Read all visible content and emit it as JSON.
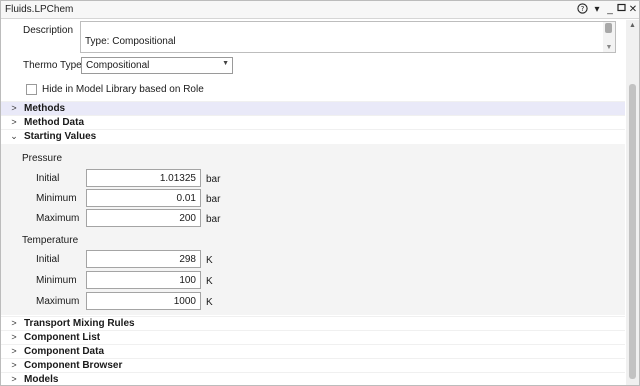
{
  "window": {
    "title": "Fluids.LPChem"
  },
  "description": {
    "label": "Description",
    "text": "Type: Compositional"
  },
  "thermo_type": {
    "label": "Thermo Type",
    "value": "Compositional"
  },
  "hide_checkbox": {
    "label": "Hide in Model Library based on Role",
    "checked": false
  },
  "sections_top": [
    {
      "label": "Methods",
      "expanded": false
    },
    {
      "label": "Method Data",
      "expanded": false
    },
    {
      "label": "Starting Values",
      "expanded": true
    }
  ],
  "starting_values": {
    "pressure": {
      "label": "Pressure",
      "rows": [
        {
          "label": "Initial",
          "value": "1.01325",
          "unit": "bar"
        },
        {
          "label": "Minimum",
          "value": "0.01",
          "unit": "bar"
        },
        {
          "label": "Maximum",
          "value": "200",
          "unit": "bar"
        }
      ]
    },
    "temperature": {
      "label": "Temperature",
      "rows": [
        {
          "label": "Initial",
          "value": "298",
          "unit": "K"
        },
        {
          "label": "Minimum",
          "value": "100",
          "unit": "K"
        },
        {
          "label": "Maximum",
          "value": "1000",
          "unit": "K"
        }
      ]
    }
  },
  "sections_bottom": [
    {
      "label": "Transport Mixing Rules"
    },
    {
      "label": "Component List"
    },
    {
      "label": "Component Data"
    },
    {
      "label": "Component Browser"
    },
    {
      "label": "Models"
    }
  ],
  "icons": {
    "help": "help-icon",
    "dropdown": "dropdown-icon",
    "minimize": "minimize-icon",
    "maximize": "maximize-icon",
    "close": "close-icon",
    "chevron_right": "chevron-right-icon",
    "chevron_down": "chevron-down-icon"
  },
  "colors": {
    "section_highlight": "#e9e9f8",
    "panel_bg": "#f4f4f4"
  }
}
